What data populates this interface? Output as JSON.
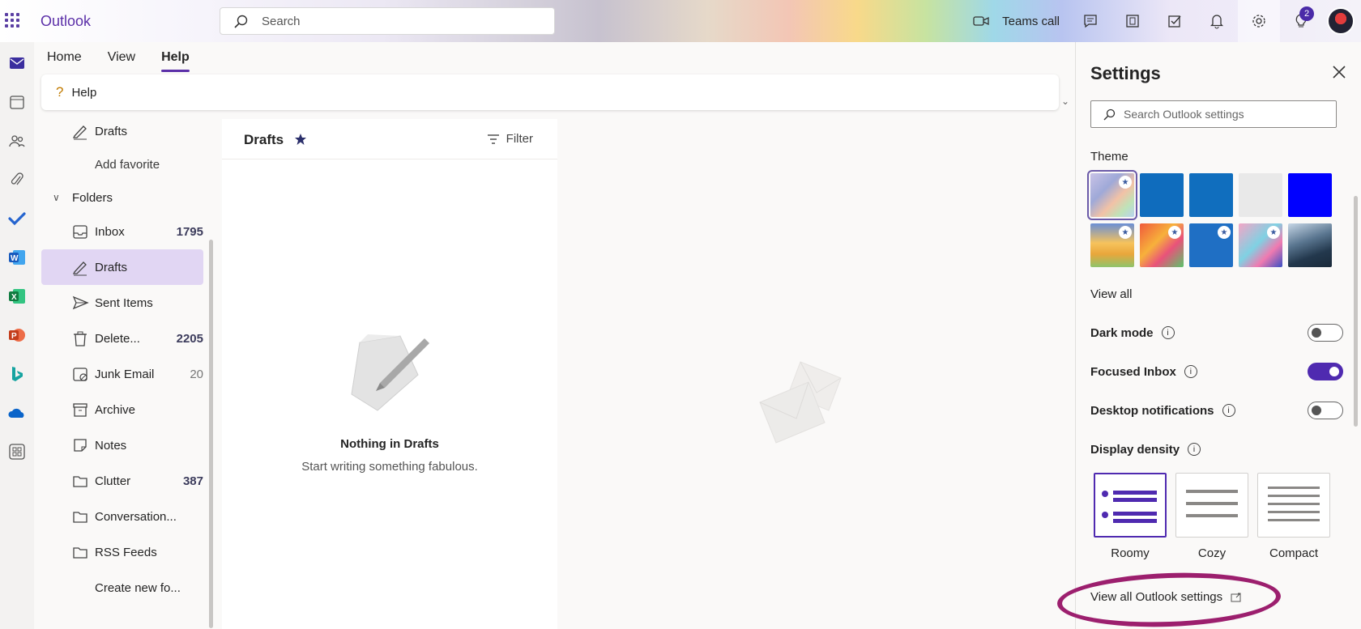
{
  "app": {
    "name": "Outlook"
  },
  "search": {
    "placeholder": "Search"
  },
  "topbar": {
    "teams_label": "Teams call",
    "notification_badge": "2"
  },
  "ribbon": {
    "tabs": [
      {
        "label": "Home"
      },
      {
        "label": "View"
      },
      {
        "label": "Help"
      }
    ],
    "active_tab": "Help",
    "help_button_label": "Help"
  },
  "folder_pane": {
    "favorites": [
      {
        "label": "Drafts",
        "icon": "pencil-icon"
      },
      {
        "label": "Add favorite"
      }
    ],
    "folders_header": "Folders",
    "folders": [
      {
        "label": "Inbox",
        "count": "1795",
        "icon": "inbox-icon"
      },
      {
        "label": "Drafts",
        "count": "",
        "icon": "pencil-icon",
        "selected": true
      },
      {
        "label": "Sent Items",
        "count": "",
        "icon": "send-icon"
      },
      {
        "label": "Delete...",
        "count": "2205",
        "icon": "trash-icon"
      },
      {
        "label": "Junk Email",
        "count": "20",
        "icon": "junk-icon"
      },
      {
        "label": "Archive",
        "count": "",
        "icon": "archive-icon"
      },
      {
        "label": "Notes",
        "count": "",
        "icon": "note-icon"
      },
      {
        "label": "Clutter",
        "count": "387",
        "icon": "folder-icon"
      },
      {
        "label": "Conversation...",
        "count": "",
        "icon": "folder-icon"
      },
      {
        "label": "RSS Feeds",
        "count": "",
        "icon": "folder-icon"
      },
      {
        "label": "Create new fo...",
        "count": ""
      }
    ]
  },
  "message_list": {
    "title": "Drafts",
    "filter_label": "Filter",
    "empty_title": "Nothing in Drafts",
    "empty_subtitle": "Start writing something fabulous."
  },
  "settings": {
    "title": "Settings",
    "search_placeholder": "Search Outlook settings",
    "theme_label": "Theme",
    "theme_colors": [
      "#0f6cbd",
      "#106ebe",
      "#e9e9e9",
      "#0000ff"
    ],
    "view_all_themes": "View all",
    "toggles": [
      {
        "label": "Dark mode",
        "on": false
      },
      {
        "label": "Focused Inbox",
        "on": true
      },
      {
        "label": "Desktop notifications",
        "on": false
      }
    ],
    "display_density_label": "Display density",
    "density_options": [
      {
        "label": "Roomy",
        "selected": true
      },
      {
        "label": "Cozy",
        "selected": false
      },
      {
        "label": "Compact",
        "selected": false
      }
    ],
    "view_all_settings": "View all Outlook settings"
  },
  "colors": {
    "accent": "#5b2fa8",
    "selected_folder": "#e1d6f3",
    "annotation_ring": "#9c1f6e"
  }
}
